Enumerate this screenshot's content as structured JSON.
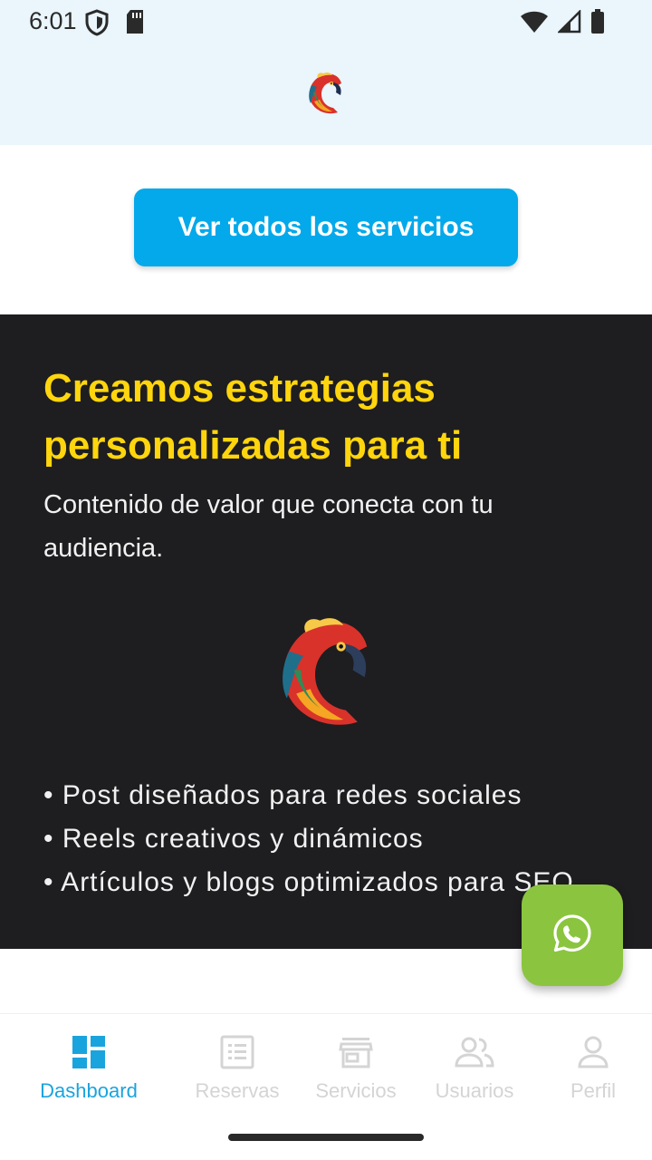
{
  "status_bar": {
    "time": "6:01",
    "icons": [
      "shield-icon",
      "sd-card-icon",
      "wifi-icon",
      "signal-icon",
      "battery-icon"
    ]
  },
  "header": {
    "logo": "parrot-logo"
  },
  "services_button": {
    "label": "Ver todos los servicios"
  },
  "promo": {
    "title": "Creamos estrategias personalizadas para ti",
    "subtitle": "Contenido de valor que conecta con tu audiencia.",
    "bullets": [
      "• Post diseñados para redes sociales",
      "• Reels creativos y dinámicos",
      "• Artículos y blogs optimizados para SEO"
    ]
  },
  "fab": {
    "icon": "whatsapp-icon"
  },
  "bottom_nav": {
    "items": [
      {
        "label": "Dashboard",
        "icon": "dashboard-icon",
        "active": true
      },
      {
        "label": "Reservas",
        "icon": "list-icon",
        "active": false
      },
      {
        "label": "Servicios",
        "icon": "store-icon",
        "active": false
      },
      {
        "label": "Usuarios",
        "icon": "users-icon",
        "active": false
      },
      {
        "label": "Perfil",
        "icon": "person-icon",
        "active": false
      }
    ]
  },
  "colors": {
    "accent": "#03a9ea",
    "title_yellow": "#ffd50d",
    "dark_bg": "#1e1d20",
    "whatsapp_green": "#8bc53f",
    "header_bg": "#eaf5fc",
    "nav_active": "#1aa4dd",
    "nav_inactive": "#d4d4d4"
  }
}
